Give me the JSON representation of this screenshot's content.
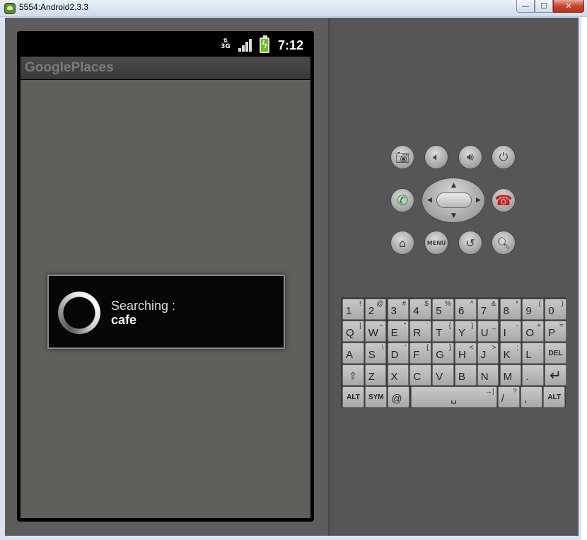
{
  "window": {
    "title": "5554:Android2.3.3",
    "min_glyph": "—",
    "max_glyph": "☐",
    "close_glyph": "✕"
  },
  "status_bar": {
    "network": "3G",
    "time": "7:12"
  },
  "app": {
    "title": "GooglePlaces"
  },
  "dialog": {
    "label": "Searching :",
    "value": "cafe"
  },
  "hardware_buttons": {
    "camera": "camera-icon",
    "volume_down": "volume-down-icon",
    "volume_up": "volume-up-icon",
    "power": "power-icon",
    "call": "call-icon",
    "end_call": "end-call-icon",
    "home": "home-icon",
    "menu_label": "MENU",
    "back": "back-icon",
    "search": "search-icon"
  },
  "keyboard": {
    "rows": [
      [
        {
          "m": "1",
          "a": "!"
        },
        {
          "m": "2",
          "a": "@"
        },
        {
          "m": "3",
          "a": "#"
        },
        {
          "m": "4",
          "a": "$"
        },
        {
          "m": "5",
          "a": "%"
        },
        {
          "m": "6",
          "a": "^"
        },
        {
          "m": "7",
          "a": "&"
        },
        {
          "m": "8",
          "a": "*"
        },
        {
          "m": "9",
          "a": "("
        },
        {
          "m": "0",
          "a": ")"
        }
      ],
      [
        {
          "m": "Q",
          "a": "|"
        },
        {
          "m": "W",
          "a": "~"
        },
        {
          "m": "E",
          "a": "\""
        },
        {
          "m": "R",
          "a": "`"
        },
        {
          "m": "T",
          "a": "{"
        },
        {
          "m": "Y",
          "a": "}"
        },
        {
          "m": "U",
          "a": "_"
        },
        {
          "m": "I",
          "a": "-"
        },
        {
          "m": "O",
          "a": "+"
        },
        {
          "m": "P",
          "a": "="
        }
      ],
      [
        {
          "m": "A",
          "a": ""
        },
        {
          "m": "S",
          "a": "\\"
        },
        {
          "m": "D",
          "a": "'"
        },
        {
          "m": "F",
          "a": "["
        },
        {
          "m": "G",
          "a": "]"
        },
        {
          "m": "H",
          "a": "<"
        },
        {
          "m": "J",
          "a": ">"
        },
        {
          "m": "K",
          "a": ";"
        },
        {
          "m": "L",
          "a": ":"
        },
        {
          "m": "DEL",
          "a": ""
        }
      ],
      [
        {
          "m": "⇧",
          "a": ""
        },
        {
          "m": "Z",
          "a": ""
        },
        {
          "m": "X",
          "a": ""
        },
        {
          "m": "C",
          "a": ""
        },
        {
          "m": "V",
          "a": ""
        },
        {
          "m": "B",
          "a": ""
        },
        {
          "m": "N",
          "a": ""
        },
        {
          "m": "M",
          "a": ""
        },
        {
          "m": ".",
          "a": ""
        },
        {
          "m": "↵",
          "a": ""
        }
      ],
      [
        {
          "m": "ALT",
          "a": ""
        },
        {
          "m": "SYM",
          "a": ""
        },
        {
          "m": "@",
          "a": ""
        },
        {
          "m": "␣",
          "a": "→|"
        },
        {
          "m": "/",
          "a": "?"
        },
        {
          "m": ",",
          "a": ""
        },
        {
          "m": "ALT",
          "a": ""
        }
      ]
    ]
  }
}
